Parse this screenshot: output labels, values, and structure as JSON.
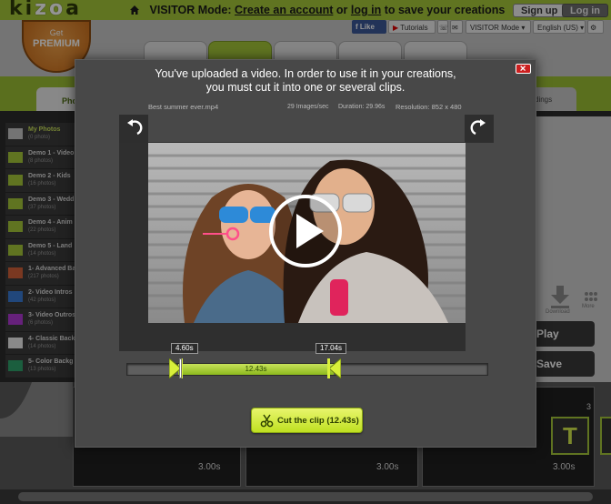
{
  "app": {
    "logo_text_a": "ki",
    "logo_text_b": "zo",
    "logo_text_c": "a"
  },
  "header": {
    "visitor_mode": "VISITOR Mode:",
    "create_account": "Create an account",
    "or": "or",
    "log_in": "log in",
    "to_save": "to save your creations",
    "sign_up": "Sign up",
    "login": "Log in"
  },
  "premium": {
    "get": "Get",
    "label": "PREMIUM"
  },
  "toolbar": {
    "like": "Like",
    "tutorials": "Tutorials",
    "mode": "VISITOR Mode",
    "language": "English (US)"
  },
  "tabs": {
    "library": "Pho",
    "settings": "dings"
  },
  "sidebar": {
    "items": [
      {
        "title": "My Photos",
        "count": "(0 photo)"
      },
      {
        "title": "Demo 1 - Video",
        "count": "(8 photos)"
      },
      {
        "title": "Demo 2 - Kids",
        "count": "(16 photos)"
      },
      {
        "title": "Demo 3 - Wedd",
        "count": "(37 photos)"
      },
      {
        "title": "Demo 4 - Anim",
        "count": "(22 photos)"
      },
      {
        "title": "Demo 5 - Land",
        "count": "(14 photos)"
      },
      {
        "title": "1- Advanced Ba",
        "count": "(217 photos)"
      },
      {
        "title": "2- Video Intros",
        "count": "(42 photos)"
      },
      {
        "title": "3- Video Outros",
        "count": "(6 photos)"
      },
      {
        "title": "4- Classic Back",
        "count": "(14 photos)"
      },
      {
        "title": "5- Color Backg",
        "count": "(13 photos)"
      }
    ]
  },
  "right_panel": {
    "download": "Download",
    "more": "More",
    "play": "Play",
    "save": "Save"
  },
  "timeline": {
    "durations": [
      "3.00s",
      "3.00s",
      "3.00s"
    ],
    "slot_number": "3",
    "text_tile": "T"
  },
  "modal": {
    "message_line1": "You've uploaded a video. In order to use it in your creations,",
    "message_line2": "you must cut it into one or several clips.",
    "file_name": "Best summer ever.mp4",
    "images_per_sec": "29 Images/sec",
    "duration": "Duration: 29.96s",
    "resolution": "Resolution: 852 x 480",
    "start_time": "4.60s",
    "end_time": "17.04s",
    "selection": "12.43s",
    "cut_button": "Cut the clip (12.43s)"
  },
  "colors": {
    "brand_green": "#a6c93a",
    "close_red": "#cc1f1f",
    "selection_green": "#9cc92a"
  },
  "icons": [
    "home-icon",
    "facebook-icon",
    "youtube-icon",
    "phone-icon",
    "mail-icon",
    "rotate-left-icon",
    "rotate-right-icon",
    "play-icon",
    "scissors-icon",
    "close-icon",
    "download-icon",
    "more-icon"
  ]
}
